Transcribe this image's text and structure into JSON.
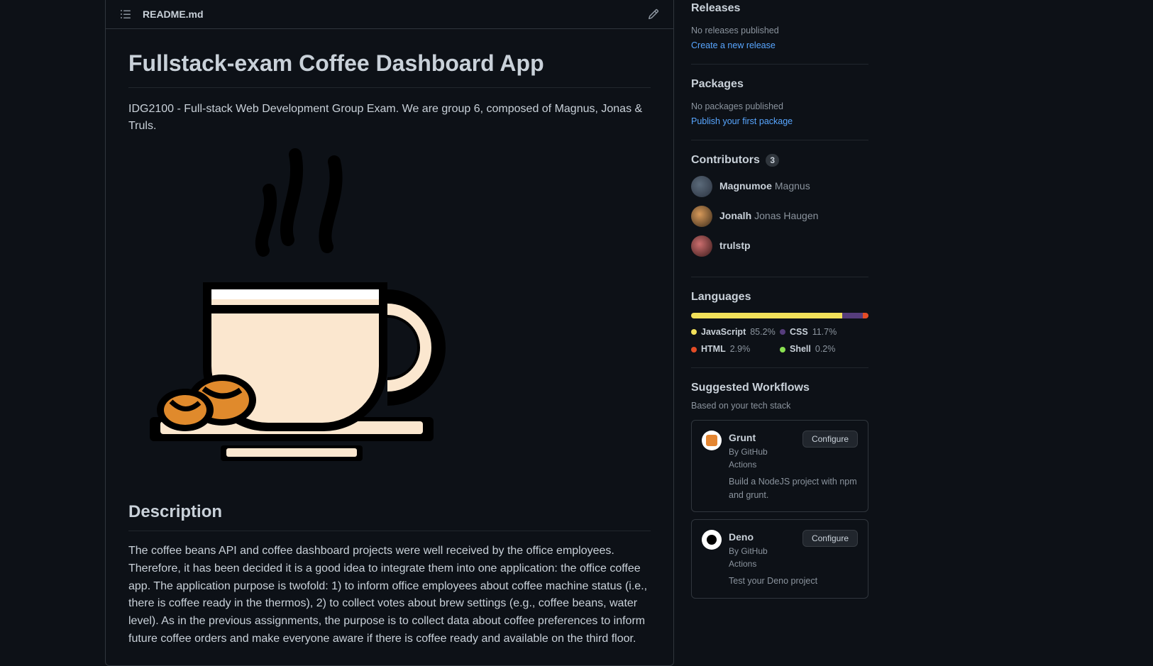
{
  "readme": {
    "filename": "README.md",
    "title": "Fullstack-exam Coffee Dashboard App",
    "intro": "IDG2100 - Full-stack Web Development Group Exam. We are group 6, composed of Magnus, Jonas & Truls.",
    "description_heading": "Description",
    "description": "The coffee beans API and coffee dashboard projects were well received by the office employees. Therefore, it has been decided it is a good idea to integrate them into one application: the office coffee app. The application purpose is twofold: 1) to inform office employees about coffee machine status (i.e., there is coffee ready in the thermos), 2) to collect votes about brew settings (e.g., coffee beans, water level). As in the previous assignments, the purpose is to collect data about coffee preferences to inform future coffee orders and make everyone aware if there is coffee ready and available on the third floor."
  },
  "releases": {
    "heading": "Releases",
    "none": "No releases published",
    "link": "Create a new release"
  },
  "packages": {
    "heading": "Packages",
    "none": "No packages published",
    "link": "Publish your first package"
  },
  "contributors": {
    "heading": "Contributors",
    "count": "3",
    "list": [
      {
        "login": "Magnumoe",
        "name": "Magnus"
      },
      {
        "login": "Jonalh",
        "name": "Jonas Haugen"
      },
      {
        "login": "trulstp",
        "name": ""
      }
    ]
  },
  "languages": {
    "heading": "Languages",
    "list": [
      {
        "name": "JavaScript",
        "pct": "85.2%",
        "color": "#f1e05a"
      },
      {
        "name": "CSS",
        "pct": "11.7%",
        "color": "#563d7c"
      },
      {
        "name": "HTML",
        "pct": "2.9%",
        "color": "#e34c26"
      },
      {
        "name": "Shell",
        "pct": "0.2%",
        "color": "#89e051"
      }
    ]
  },
  "workflows": {
    "heading": "Suggested Workflows",
    "sub": "Based on your tech stack",
    "configure": "Configure",
    "list": [
      {
        "icon": "grunt",
        "name": "Grunt",
        "by": "By GitHub Actions",
        "desc": "Build a NodeJS project with npm and grunt."
      },
      {
        "icon": "deno",
        "name": "Deno",
        "by": "By GitHub Actions",
        "desc": "Test your Deno project"
      }
    ]
  }
}
